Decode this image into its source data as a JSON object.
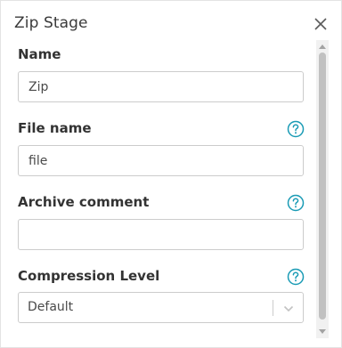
{
  "dialog": {
    "title": "Zip Stage"
  },
  "fields": {
    "name": {
      "label": "Name",
      "value": "Zip"
    },
    "file_name": {
      "label": "File name",
      "value": "file"
    },
    "archive_comment": {
      "label": "Archive comment",
      "value": ""
    },
    "compression_level": {
      "label": "Compression Level",
      "selected": "Default"
    }
  },
  "icons": {
    "close": "close-icon",
    "help": "help-circle-icon",
    "dropdown": "chevron-down-icon"
  },
  "colors": {
    "accent": "#1a9bb5",
    "border": "#cccccc",
    "text": "#333333"
  }
}
